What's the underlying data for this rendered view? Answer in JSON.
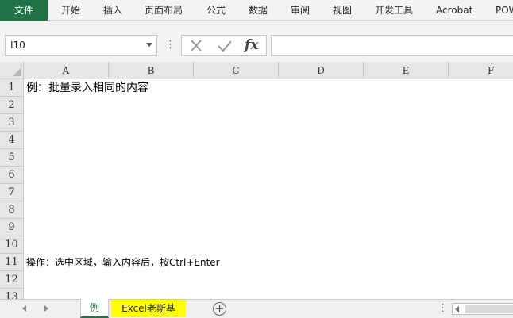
{
  "ribbon": {
    "tabs": [
      {
        "label": "文件",
        "active": true
      },
      {
        "label": "开始"
      },
      {
        "label": "插入"
      },
      {
        "label": "页面布局"
      },
      {
        "label": "公式"
      },
      {
        "label": "数据"
      },
      {
        "label": "审阅"
      },
      {
        "label": "视图"
      },
      {
        "label": "开发工具"
      },
      {
        "label": "Acrobat"
      },
      {
        "label": "POW"
      }
    ]
  },
  "formula_bar": {
    "name_box": "I10",
    "fx_label": "fx",
    "formula_value": "",
    "icons": [
      "cancel-x-icon",
      "enter-check-icon",
      "insert-function-icon"
    ]
  },
  "sheet": {
    "columns": [
      "A",
      "B",
      "C",
      "D",
      "E",
      "F"
    ],
    "rows": [
      "1",
      "2",
      "3",
      "4",
      "5",
      "6",
      "7",
      "8",
      "9",
      "10",
      "11",
      "12",
      "13"
    ],
    "cells": {
      "A1": "例：批量录入相同的内容",
      "A11": "操作：选中区域，输入内容后，按Ctrl+Enter"
    }
  },
  "sheet_tabs": {
    "tabs": [
      {
        "label": "例",
        "active": true
      },
      {
        "label": "Excel老斯基",
        "color": "#ffff00"
      }
    ],
    "add_icon": "plus-circle-icon"
  },
  "colors": {
    "file_tab": "#217346",
    "active_sheet_text": "#217346",
    "highlight_tab": "#ffff00"
  }
}
